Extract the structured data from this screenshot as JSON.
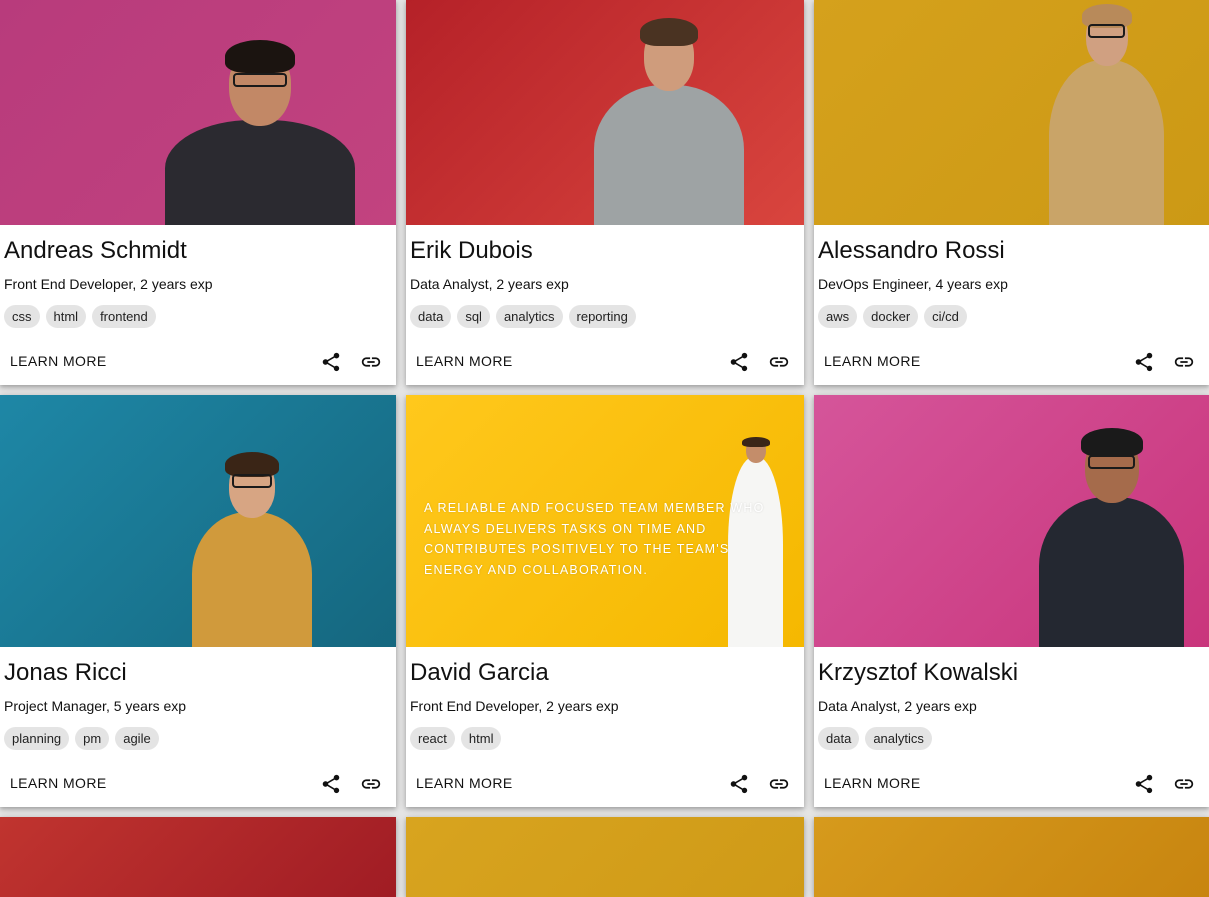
{
  "cards": [
    {
      "name": "Andreas Schmidt",
      "role": "Front End Developer, 2 years exp",
      "tags": [
        "css",
        "html",
        "frontend"
      ],
      "photo_bg": [
        "#b83b7c",
        "#c2437f"
      ],
      "shirt": "#2b2a30"
    },
    {
      "name": "Erik Dubois",
      "role": "Data Analyst, 2 years exp",
      "tags": [
        "data",
        "sql",
        "analytics",
        "reporting"
      ],
      "photo_bg": [
        "#b52128",
        "#d9453e"
      ],
      "shirt": "#9ea3a4"
    },
    {
      "name": "Alessandro Rossi",
      "role": "DevOps Engineer, 4 years exp",
      "tags": [
        "aws",
        "docker",
        "ci/cd"
      ],
      "photo_bg": [
        "#d5a11c",
        "#cc9915"
      ],
      "shirt": "#c9a468"
    },
    {
      "name": "Jonas Ricci",
      "role": "Project Manager, 5 years exp",
      "tags": [
        "planning",
        "pm",
        "agile"
      ],
      "photo_bg": [
        "#1e87a6",
        "#15677f"
      ],
      "shirt": "#d09a3c"
    },
    {
      "name": "David Garcia",
      "role": "Front End Developer, 2 years exp",
      "tags": [
        "react",
        "html"
      ],
      "photo_bg": [
        "#ffc81c",
        "#f5b800"
      ],
      "shirt": "#f6f6f4",
      "overlay": "A RELIABLE AND FOCUSED TEAM MEMBER WHO ALWAYS DELIVERS TASKS ON TIME AND CONTRIBUTES POSITIVELY TO THE TEAM'S ENERGY AND COLLABORATION."
    },
    {
      "name": "Krzysztof Kowalski",
      "role": "Data Analyst, 2 years exp",
      "tags": [
        "data",
        "analytics"
      ],
      "photo_bg": [
        "#d5559a",
        "#c9357c"
      ],
      "shirt": "#242831"
    }
  ],
  "actions": {
    "learn_more": "LEARN MORE",
    "share_icon": "share-icon",
    "link_icon": "link-icon"
  },
  "partial_row": {
    "photo_bgs": [
      [
        "#c0342f",
        "#a01c24"
      ],
      [
        "#d8a41f",
        "#cf9a17"
      ],
      [
        "#d69a1c",
        "#c88510"
      ]
    ]
  }
}
